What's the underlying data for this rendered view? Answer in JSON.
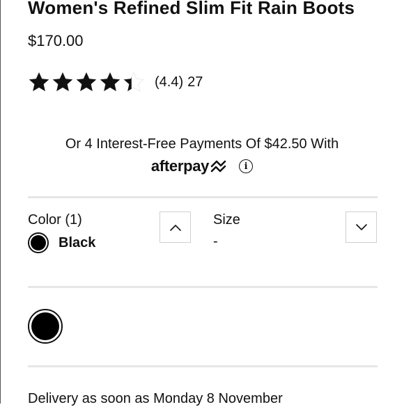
{
  "product": {
    "title": "Women's Refined Slim Fit Rain Boots",
    "price": "$170.00"
  },
  "rating": {
    "value": 4.4,
    "value_text": "(4.4)",
    "count": "27",
    "max": 5
  },
  "payment": {
    "installments_text": "Or 4 Interest-Free Payments Of $42.50 With",
    "provider_logo_text": "afterpay",
    "info_icon": "info-icon"
  },
  "color": {
    "label": "Color (1)",
    "selected": "Black",
    "swatch_color": "#000000",
    "toggle_icon": "chevron-up-icon"
  },
  "size": {
    "label": "Size",
    "selected": "-",
    "toggle_icon": "chevron-down-icon"
  },
  "delivery": {
    "text": "Delivery as soon as Monday 8 November"
  },
  "colors": {
    "text": "#111111",
    "divider": "#e6e6e6",
    "star_fill": "#111111",
    "star_empty": "#ffffff"
  }
}
